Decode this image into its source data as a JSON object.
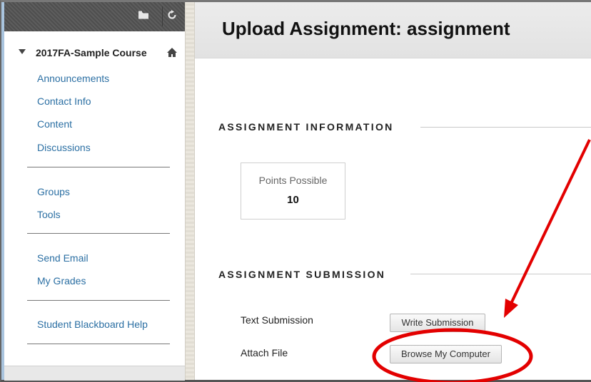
{
  "sidebar": {
    "course_title": "2017FA-Sample Course",
    "toolbar_icons": [
      "folder-icon",
      "refresh-icon"
    ],
    "groups": [
      [
        {
          "label": "Announcements",
          "name": "sidebar-item-announcements"
        },
        {
          "label": "Contact Info",
          "name": "sidebar-item-contact-info"
        },
        {
          "label": "Content",
          "name": "sidebar-item-content"
        },
        {
          "label": "Discussions",
          "name": "sidebar-item-discussions"
        }
      ],
      [
        {
          "label": "Groups",
          "name": "sidebar-item-groups"
        },
        {
          "label": "Tools",
          "name": "sidebar-item-tools"
        }
      ],
      [
        {
          "label": "Send Email",
          "name": "sidebar-item-send-email"
        },
        {
          "label": "My Grades",
          "name": "sidebar-item-my-grades"
        }
      ],
      [
        {
          "label": "Student Blackboard Help",
          "name": "sidebar-item-student-blackboard-help"
        }
      ]
    ]
  },
  "main": {
    "page_title": "Upload Assignment: assignment",
    "assignment_information": {
      "heading": "ASSIGNMENT INFORMATION",
      "points_label": "Points Possible",
      "points_value": "10"
    },
    "assignment_submission": {
      "heading": "ASSIGNMENT SUBMISSION",
      "text_submission_label": "Text Submission",
      "write_submission_button": "Write Submission",
      "attach_file_label": "Attach File",
      "browse_button": "Browse My Computer"
    }
  },
  "annotation": {
    "color": "#e30000",
    "shapes": [
      "arrow",
      "ellipse"
    ]
  },
  "colors": {
    "link": "#2b6fa3",
    "sidebar_strip": "#a9c4de"
  }
}
